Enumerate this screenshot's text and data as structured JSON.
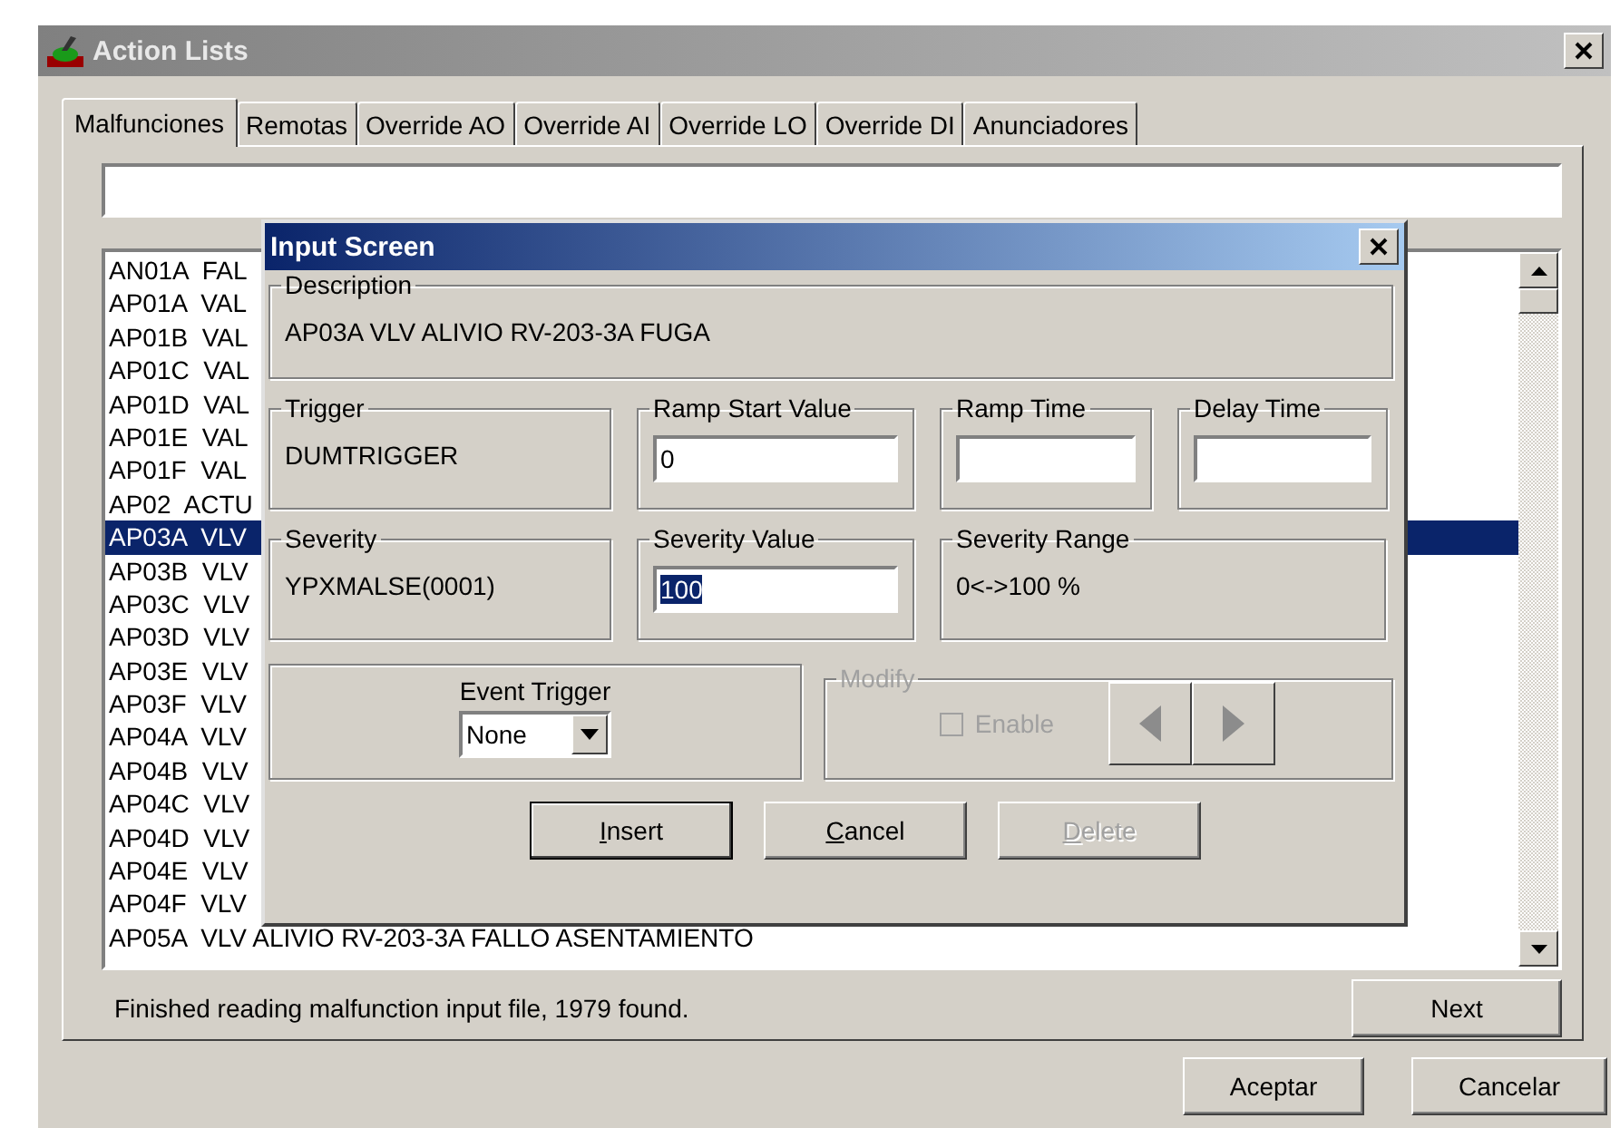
{
  "window": {
    "title": "Action Lists"
  },
  "tabs": [
    {
      "label": "Malfunciones",
      "selected": true
    },
    {
      "label": "Remotas",
      "selected": false
    },
    {
      "label": "Override AO",
      "selected": false
    },
    {
      "label": "Override AI",
      "selected": false
    },
    {
      "label": "Override LO",
      "selected": false
    },
    {
      "label": "Override DI",
      "selected": false
    },
    {
      "label": "Anunciadores",
      "selected": false
    }
  ],
  "list": {
    "rows": [
      {
        "text": "AN01A  FAL",
        "selected": false
      },
      {
        "text": "AP01A  VAL",
        "selected": false
      },
      {
        "text": "AP01B  VAL",
        "selected": false
      },
      {
        "text": "AP01C  VAL",
        "selected": false
      },
      {
        "text": "AP01D  VAL",
        "selected": false
      },
      {
        "text": "AP01E  VAL",
        "selected": false
      },
      {
        "text": "AP01F  VAL",
        "selected": false
      },
      {
        "text": "AP02  ACTU",
        "selected": false
      },
      {
        "text": "AP03A  VLV",
        "selected": true
      },
      {
        "text": "AP03B  VLV",
        "selected": false
      },
      {
        "text": "AP03C  VLV",
        "selected": false
      },
      {
        "text": "AP03D  VLV",
        "selected": false
      },
      {
        "text": "AP03E  VLV",
        "selected": false
      },
      {
        "text": "AP03F  VLV",
        "selected": false
      },
      {
        "text": "AP04A  VLV",
        "selected": false
      },
      {
        "text": "AP04B  VLV",
        "selected": false
      },
      {
        "text": "AP04C  VLV",
        "selected": false
      },
      {
        "text": "AP04D  VLV",
        "selected": false
      },
      {
        "text": "AP04E  VLV",
        "selected": false
      },
      {
        "text": "AP04F  VLV",
        "selected": false
      },
      {
        "text": "AP05A  VLV ALIVIO RV-203-3A FALLO ASENTAMIENTO",
        "selected": false
      }
    ]
  },
  "status_text": "Finished reading malfunction input file, 1979 found.",
  "next_button": "Next",
  "footer_buttons": [
    "Aceptar",
    "Cancelar"
  ],
  "dialog": {
    "title": "Input Screen",
    "description": {
      "label": "Description",
      "text": "AP03A  VLV ALIVIO RV-203-3A  FUGA"
    },
    "trigger": {
      "label": "Trigger",
      "text": "DUMTRIGGER"
    },
    "ramp_start": {
      "label": "Ramp Start Value",
      "value": "0"
    },
    "ramp_time": {
      "label": "Ramp Time"
    },
    "delay_time": {
      "label": "Delay Time"
    },
    "severity": {
      "label": "Severity",
      "text": "YPXMALSE(0001)"
    },
    "severity_value": {
      "label": "Severity Value",
      "value": "100",
      "selected": true
    },
    "severity_range": {
      "label": "Severity Range",
      "text": "0<->100 %"
    },
    "event_trigger": {
      "label": "Event Trigger",
      "value": "None"
    },
    "modify": {
      "label": "Modify",
      "disabled": true,
      "enable": {
        "label": "Enable",
        "checked": false
      }
    },
    "buttons": [
      {
        "label": "Insert",
        "disabled": false,
        "default": true
      },
      {
        "label": "Cancel",
        "disabled": false,
        "default": false
      },
      {
        "label": "Delete",
        "disabled": true,
        "default": false
      }
    ]
  }
}
